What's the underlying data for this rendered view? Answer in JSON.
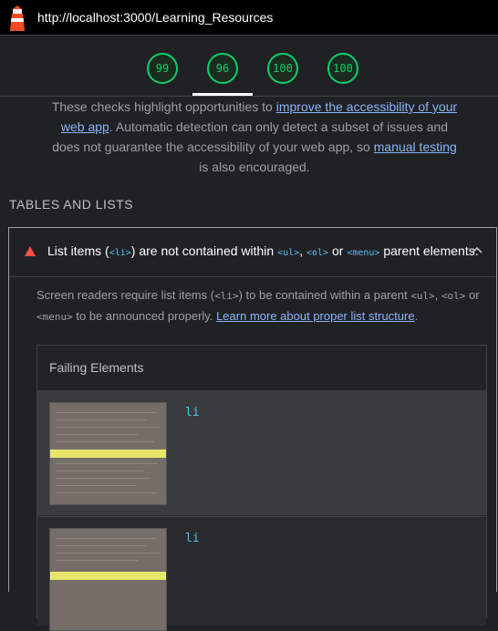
{
  "header": {
    "url": "http://localhost:3000/Learning_Resources"
  },
  "scores": [
    {
      "value": "99",
      "color": "#0cce6b"
    },
    {
      "value": "96",
      "color": "#0cce6b"
    },
    {
      "value": "100",
      "color": "#0cce6b"
    },
    {
      "value": "100",
      "color": "#0cce6b"
    }
  ],
  "intro": {
    "text1": "These checks highlight opportunities to ",
    "link1": "improve the accessibility of your web app",
    "text2": ". Automatic detection can only detect a subset of issues and does not guarantee the accessibility of your web app, so ",
    "link2": "manual testing",
    "text3": " is also encouraged."
  },
  "section": {
    "title": "TABLES AND LISTS"
  },
  "audit": {
    "title_a": "List items (",
    "code_li": "<li>",
    "title_b": ") are not contained within ",
    "code_ul": "<ul>",
    "sep1": ", ",
    "code_ol": "<ol>",
    "title_c": " or ",
    "code_menu": "<menu>",
    "title_d": " parent elements.",
    "desc_a": "Screen readers require list items (",
    "desc_li": "<li>",
    "desc_b": ") to be contained within a parent ",
    "desc_ul": "<ul>",
    "desc_sep": ", ",
    "desc_ol": "<ol>",
    "desc_c": " or ",
    "desc_menu": "<menu>",
    "desc_d": " to be announced properly. ",
    "learn_link": "Learn more about proper list structure",
    "desc_end": ".",
    "failing_header": "Failing Elements",
    "items": [
      {
        "node": "li"
      },
      {
        "node": "li"
      }
    ]
  }
}
